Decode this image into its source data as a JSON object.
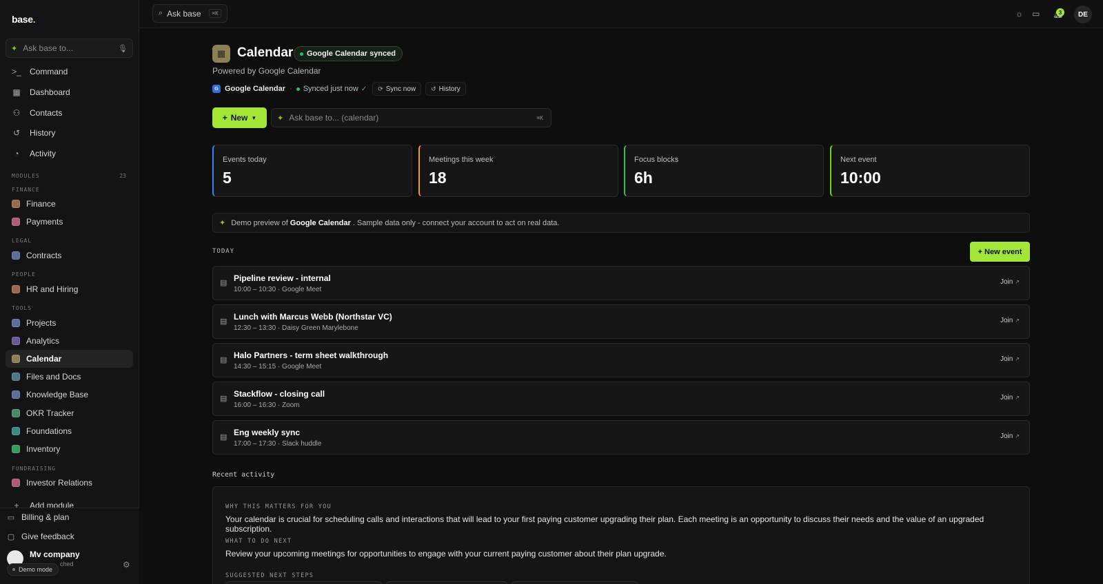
{
  "app": {
    "logo": "base",
    "logo_dot": "."
  },
  "sidebar": {
    "ask_placeholder": "Ask base to...",
    "nav": [
      {
        "label": "Command",
        "icon": "terminal-icon"
      },
      {
        "label": "Dashboard",
        "icon": "grid-icon"
      },
      {
        "label": "Contacts",
        "icon": "users-icon"
      },
      {
        "label": "History",
        "icon": "history-icon"
      },
      {
        "label": "Activity",
        "icon": "activity-icon"
      }
    ],
    "modules_label": "MODULES",
    "modules_count": "23",
    "sections": {
      "finance": "FINANCE",
      "legal": "LEGAL",
      "people": "PEOPLE",
      "tools": "TOOLS",
      "fundraising": "FUNDRAISING"
    },
    "modules": [
      {
        "label": "Finance",
        "color": "#9a6a4a"
      },
      {
        "label": "Payments",
        "color": "#b05a7a"
      },
      {
        "label": "Contracts",
        "color": "#5a6f9a"
      },
      {
        "label": "HR and Hiring",
        "color": "#9a6a4a"
      },
      {
        "label": "Projects",
        "color": "#5a6f9a"
      },
      {
        "label": "Analytics",
        "color": "#6a5a9a"
      },
      {
        "label": "Calendar",
        "color": "#8b8152"
      },
      {
        "label": "Files and Docs",
        "color": "#4a7a8a"
      },
      {
        "label": "Knowledge Base",
        "color": "#5a6f9a"
      },
      {
        "label": "OKR Tracker",
        "color": "#4a8a6a"
      },
      {
        "label": "Foundations",
        "color": "#3a8a8a"
      },
      {
        "label": "Inventory",
        "color": "#3a9a5a"
      },
      {
        "label": "Investor Relations",
        "color": "#b05a7a"
      }
    ],
    "add_module": "Add module",
    "billing": "Billing & plan",
    "feedback": "Give feedback",
    "company_name": "Mv company",
    "company_sub": "ched",
    "demo_mode": "Demo mode"
  },
  "topbar": {
    "search_label": "Ask base",
    "search_kbd": "⌘K",
    "notifications_count": "3",
    "user_initials": "DE"
  },
  "page": {
    "title": "Calendar",
    "synced_badge": "Google Calendar synced",
    "subtitle": "Powered by Google Calendar",
    "source_icon_letter": "G",
    "source_name": "Google Calendar",
    "sync_status": "Synced just now",
    "sync_now": "Sync now",
    "history": "History",
    "new_button": "New",
    "ask_placeholder": "Ask base to... (calendar)",
    "ask_kbd": "⌘K"
  },
  "stats": [
    {
      "label": "Events today",
      "value": "5",
      "accent": "#3b82f6"
    },
    {
      "label": "Meetings this week",
      "value": "18",
      "accent": "#f59e0b"
    },
    {
      "label": "Focus blocks",
      "value": "6h",
      "accent": "#22c55e"
    },
    {
      "label": "Next event",
      "value": "10:00",
      "accent": "#84cc16"
    }
  ],
  "notice": {
    "prefix": "Demo preview of",
    "product": "Google Calendar",
    "suffix": ". Sample data only - connect your account to act on real data."
  },
  "today": {
    "label": "TODAY",
    "new_event": "+ New event",
    "join_label": "Join",
    "events": [
      {
        "title": "Pipeline review - internal",
        "meta": "10:00 – 10:30 · Google Meet"
      },
      {
        "title": "Lunch with Marcus Webb (Northstar VC)",
        "meta": "12:30 – 13:30 · Daisy Green Marylebone"
      },
      {
        "title": "Halo Partners - term sheet walkthrough",
        "meta": "14:30 – 15:15 · Google Meet"
      },
      {
        "title": "Stackflow - closing call",
        "meta": "16:00 – 16:30 · Zoom"
      },
      {
        "title": "Eng weekly sync",
        "meta": "17:00 – 17:30 · Slack huddle"
      }
    ]
  },
  "recent": {
    "label": "Recent activity",
    "why_heading": "WHY THIS MATTERS FOR YOU",
    "why_text": "Your calendar is crucial for scheduling calls and interactions that will lead to your first paying customer upgrading their plan. Each meeting is an opportunity to discuss their needs and the value of an upgraded subscription.",
    "next_heading": "WHAT TO DO NEXT",
    "next_text": "Review your upcoming meetings for opportunities to engage with your current paying customer about their plan upgrade.",
    "steps_heading": "SUGGESTED NEXT STEPS"
  }
}
